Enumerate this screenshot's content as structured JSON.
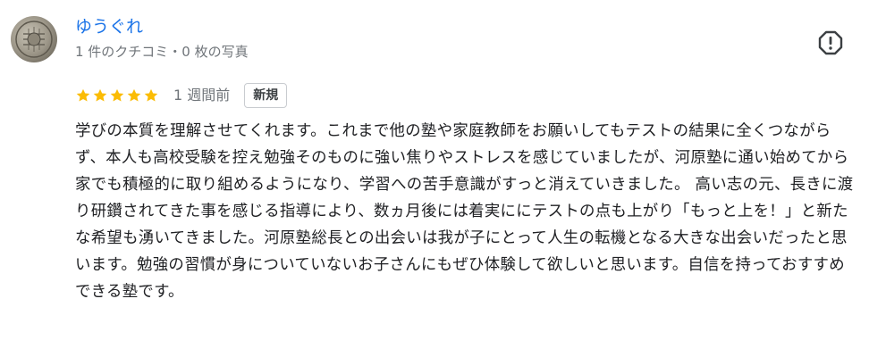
{
  "reviewer": {
    "name": "ゆうぐれ",
    "meta": "1 件のクチコミ・0 枚の写真"
  },
  "rating": {
    "stars": 5,
    "max_stars": 5,
    "time": "1 週間前",
    "badge": "新規",
    "star_color": "#fbbc04"
  },
  "review": {
    "text": "学びの本質を理解させてくれます。これまで他の塾や家庭教師をお願いしてもテストの結果に全くつながらず、本人も高校受験を控え勉強そのものに強い焦りやストレスを感じていましたが、河原塾に通い始めてから家でも積極的に取り組めるようになり、学習への苦手意識がすっと消えていきました。 高い志の元、長きに渡り研鑽されてきた事を感じる指導により、数ヵ月後には着実ににテストの点も上がり「もっと上を！」と新たな希望も湧いてきました。河原塾総長との出会いは我が子にとって人生の転機となる大きな出会いだったと思います。勉強の習慣が身についていないお子さんにもぜひ体験して欲しいと思います。自信を持っておすすめできる塾です。"
  },
  "icons": {
    "avatar": "reviewer-avatar",
    "report": "report-flag-icon",
    "star": "star-icon"
  },
  "colors": {
    "name_link": "#1a73e8",
    "meta_text": "#70757a",
    "body_text": "#202124"
  }
}
